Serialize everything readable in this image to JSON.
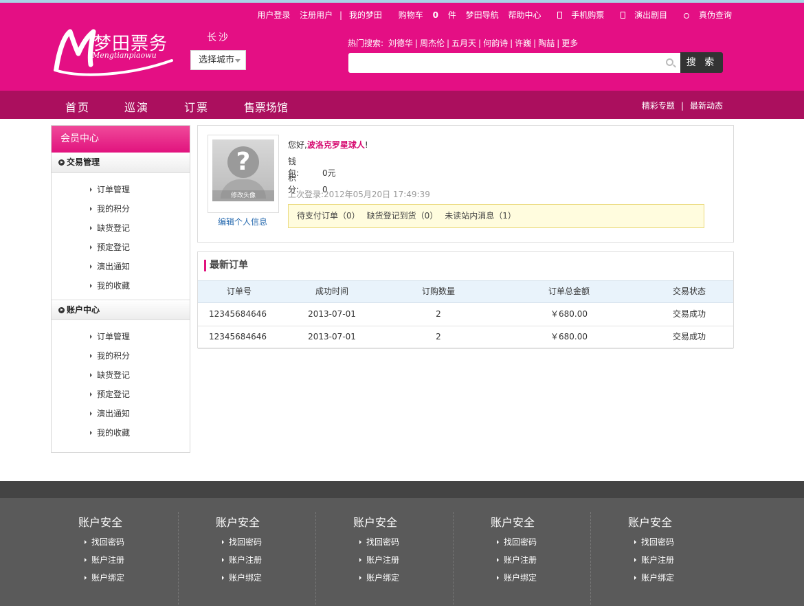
{
  "header": {
    "top_links": [
      "用户登录",
      "注册用户",
      "我的梦田",
      "购物车",
      "0",
      "件",
      "梦田导航",
      "帮助中心",
      "手机购票",
      "演出剧目",
      "真伪查询"
    ],
    "logo_cn": "梦田票务",
    "logo_en": "Mengtianpiaowu",
    "city_name": "长沙",
    "city_select": "选择城市",
    "hot_label": "热门搜索:",
    "hot_keywords": [
      "刘德华",
      "周杰伦",
      "五月天",
      "何韵诗",
      "许巍",
      "陶喆",
      "更多"
    ],
    "search_button": "搜 索"
  },
  "nav": {
    "items": [
      "首页",
      "巡演",
      "订票",
      "售票场馆"
    ],
    "right": [
      "精彩专题",
      "最新动态"
    ]
  },
  "sidebar": {
    "title": "会员中心",
    "groups": [
      {
        "title": "交易管理",
        "items": [
          "订单管理",
          "我的积分",
          "缺货登记",
          "预定登记",
          "演出通知",
          "我的收藏"
        ]
      },
      {
        "title": "账户中心",
        "items": [
          "订单管理",
          "我的积分",
          "缺货登记",
          "预定登记",
          "演出通知",
          "我的收藏"
        ]
      }
    ]
  },
  "profile": {
    "avatar_caption": "修改头像",
    "edit_link": "编辑个人信息",
    "greeting": "您好,",
    "username": "波洛克罗星球人",
    "greeting_end": "!",
    "wallet_label": "钱　　包:",
    "wallet_value": "0元",
    "points_label": "积　　分:",
    "points_value": "0",
    "last_login": "上次登录:2012年05月20日 17:49:39",
    "notices": [
      "待支付订单（0）",
      "缺货登记到货（0）",
      "未读站内消息（1）"
    ]
  },
  "orders": {
    "title": "最新订单",
    "columns": [
      "订单号",
      "成功时间",
      "订购数量",
      "订单总金额",
      "交易状态"
    ],
    "rows": [
      [
        "12345684646",
        "2013-07-01",
        "2",
        "￥680.00",
        "交易成功"
      ],
      [
        "12345684646",
        "2013-07-01",
        "2",
        "￥680.00",
        "交易成功"
      ]
    ]
  },
  "footer": {
    "columns": [
      {
        "title": "账户安全",
        "links": [
          "找回密码",
          "账户注册",
          "账户绑定"
        ]
      },
      {
        "title": "账户安全",
        "links": [
          "找回密码",
          "账户注册",
          "账户绑定"
        ]
      },
      {
        "title": "账户安全",
        "links": [
          "找回密码",
          "账户注册",
          "账户绑定"
        ]
      },
      {
        "title": "账户安全",
        "links": [
          "找回密码",
          "账户注册",
          "账户绑定"
        ]
      },
      {
        "title": "账户安全",
        "links": [
          "找回密码",
          "账户注册",
          "账户绑定"
        ]
      }
    ]
  },
  "colors": {
    "brand": "#e40f84",
    "nav": "#ab0f5e",
    "footer": "#5a5a5a",
    "accent_text": "#d6086f"
  }
}
